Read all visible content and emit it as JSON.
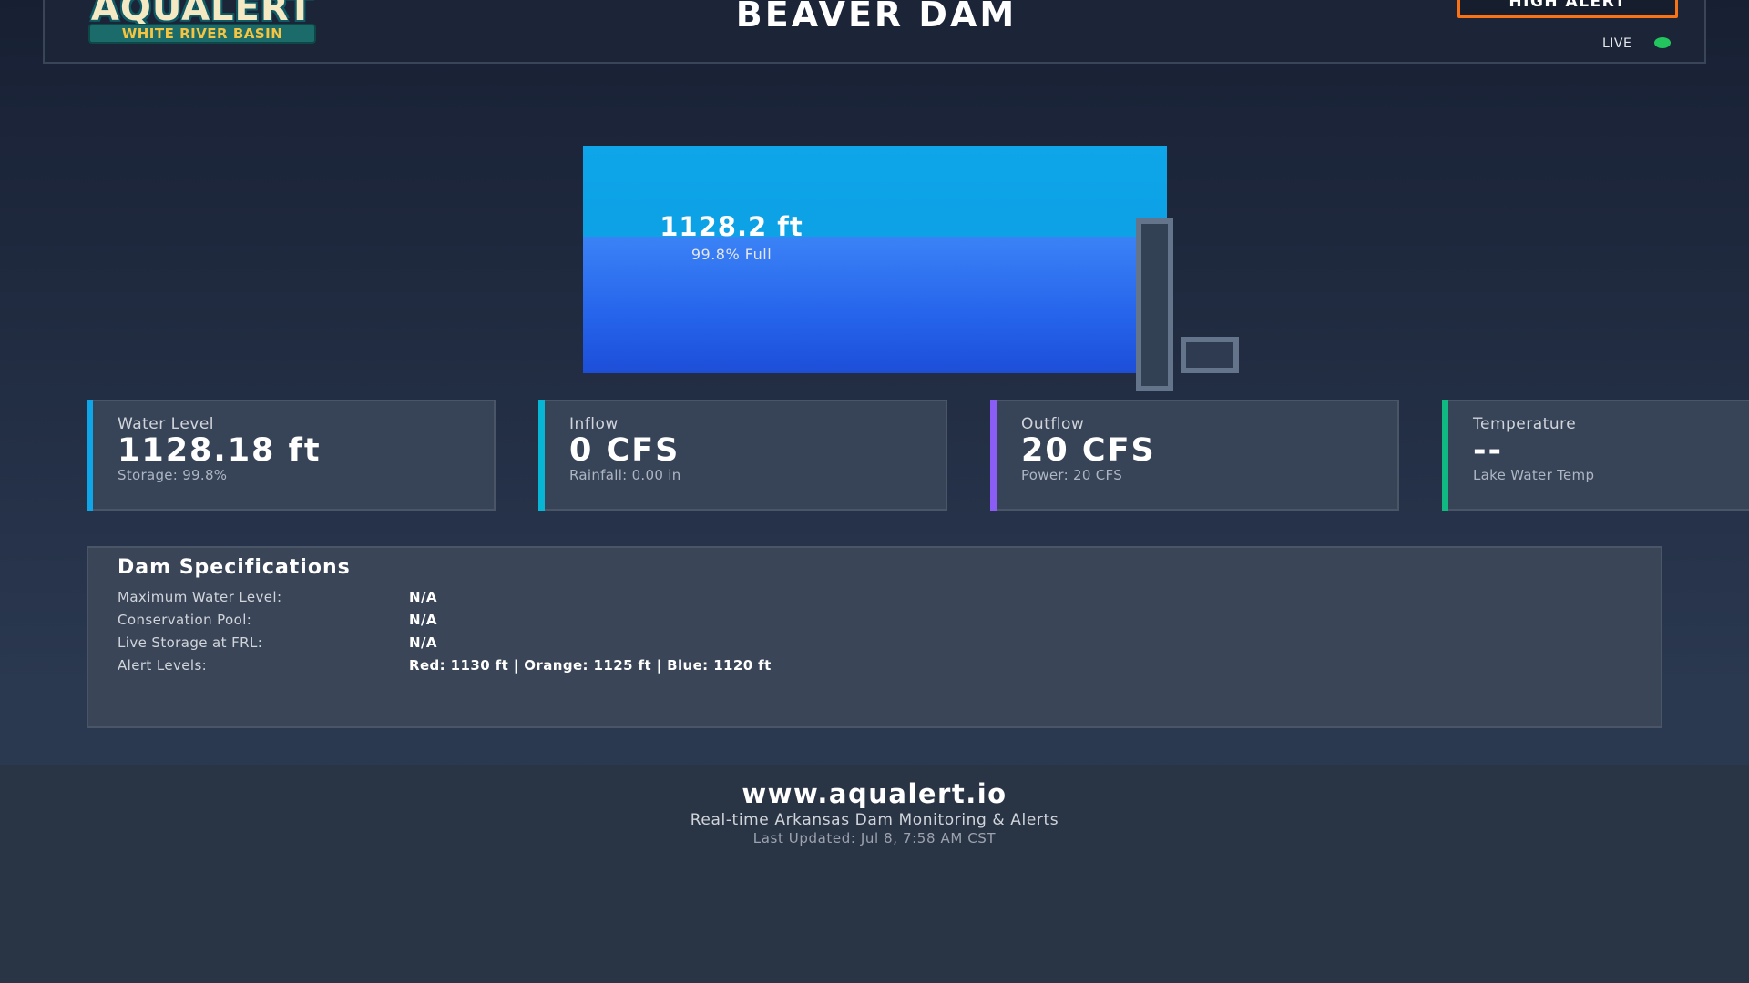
{
  "header": {
    "logo": {
      "wordmark": "AQUALERT",
      "subtitle": "WHITE RIVER BASIN"
    },
    "title": "BEAVER DAM",
    "alert_status": "HIGH ALERT",
    "alert_color": "#f97316",
    "live_label": "LIVE",
    "live_color": "#22c55e"
  },
  "reservoir": {
    "level_label": "1128.2 ft",
    "percent_label": "99.8% Full",
    "fill_fraction": 0.6
  },
  "metrics": [
    {
      "label": "Water Level",
      "value": "1128.18 ft",
      "sub": "Storage: 99.8%",
      "accent": "#0ea5e9"
    },
    {
      "label": "Inflow",
      "value": "0 CFS",
      "sub": "Rainfall: 0.00 in",
      "accent": "#06b6d4"
    },
    {
      "label": "Outflow",
      "value": "20 CFS",
      "sub": "Power: 20 CFS",
      "accent": "#8b5cf6"
    },
    {
      "label": "Temperature",
      "value": "--",
      "sub": "Lake Water Temp",
      "accent": "#10b981"
    }
  ],
  "specs": {
    "title": "Dam Specifications",
    "rows": [
      {
        "label": "Maximum Water Level:",
        "value": "N/A"
      },
      {
        "label": "Conservation Pool:",
        "value": "N/A"
      },
      {
        "label": "Live Storage at FRL:",
        "value": "N/A"
      },
      {
        "label": "Alert Levels:",
        "value": "Red: 1130 ft | Orange: 1125 ft | Blue: 1120 ft"
      }
    ]
  },
  "footer": {
    "url": "www.aqualert.io",
    "tagline": "Real-time Arkansas Dam Monitoring & Alerts",
    "updated": "Last Updated: Jul 8, 7:58 AM CST"
  }
}
